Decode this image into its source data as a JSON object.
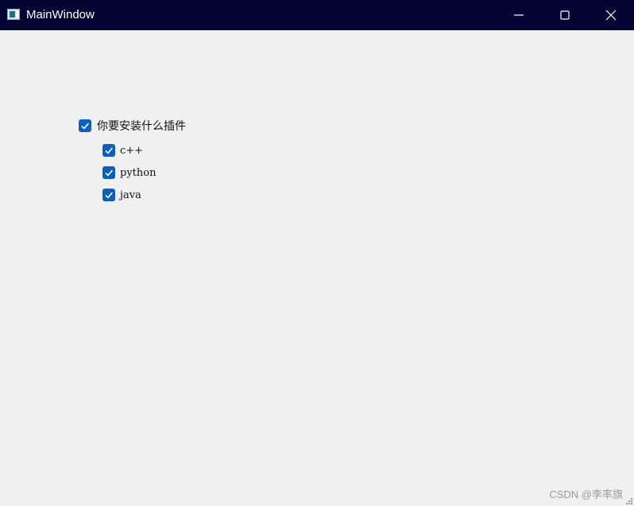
{
  "window": {
    "title": "MainWindow"
  },
  "title_buttons": [
    "minimize",
    "maximize",
    "close"
  ],
  "tree": {
    "parent": {
      "label": "你要安装什么插件",
      "checked": true
    },
    "children": [
      {
        "label": "c++",
        "checked": true
      },
      {
        "label": "python",
        "checked": true
      },
      {
        "label": "java",
        "checked": true
      }
    ]
  },
  "watermark": "CSDN @李率旗",
  "colors": {
    "titlebar": "#050533",
    "checkbox": "#0a5fbf",
    "background": "#f0f0f0"
  }
}
